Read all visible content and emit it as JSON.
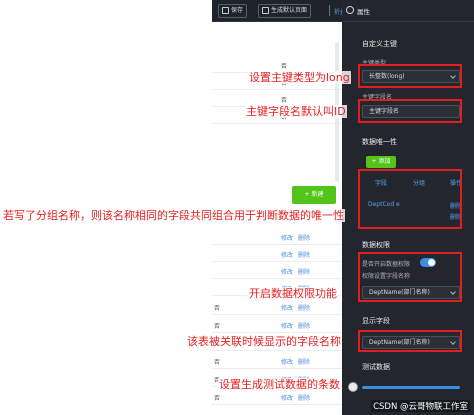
{
  "toolbar": {
    "save_label": "保存",
    "default_page_label": "生成默认页面",
    "collapse_label": "折叠属性"
  },
  "table": {
    "rows_top": [
      {
        "value": "否"
      },
      {
        "value": "否"
      },
      {
        "value": "否"
      },
      {
        "value": "否"
      }
    ],
    "new_button_label": "新建",
    "rows_bottom": [
      {
        "edit": "修改",
        "delete": "删除"
      },
      {
        "edit": "修改",
        "delete": "删除"
      },
      {
        "edit": "修改",
        "delete": "删除"
      },
      {
        "edit": "修改",
        "delete": "删除"
      },
      {
        "no": "否",
        "edit": "修改",
        "delete": "删除"
      },
      {
        "no": "否",
        "edit": "修改",
        "delete": "删除"
      },
      {
        "no": "否",
        "edit": "修改",
        "delete": "删除"
      },
      {
        "no": "否",
        "edit": "修改",
        "delete": "删除"
      },
      {
        "no": "否",
        "edit": "修改",
        "delete": "删除"
      },
      {
        "no": "否",
        "edit": "修改",
        "delete": "删除"
      }
    ]
  },
  "panel": {
    "header_title": "属性",
    "custom_pk_title": "自定义主键",
    "pk_type_label": "主键类型",
    "pk_type_value": "长整数(long)",
    "pk_field_label": "主键字段名",
    "pk_field_value": "主键字段名",
    "unique_title": "数据唯一性",
    "add_label": "添加",
    "unique_cols": {
      "field": "字段",
      "group": "分组",
      "action": "操作"
    },
    "unique_rows": [
      {
        "field": "DeptCod e",
        "delete": "删除"
      },
      {
        "field": "",
        "delete": "删除"
      }
    ],
    "perm_title": "数据权限",
    "perm_enable_label": "是否开启数据权限",
    "perm_field_label": "权限设置字段名称",
    "perm_field_value": "DeptName(部门名称)",
    "display_field_title": "显示字段",
    "display_field_value": "DeptName(部门名称)",
    "test_data_title": "测试数据"
  },
  "annotations": {
    "pk_type": "设置主键类型为long",
    "pk_field": "主键字段名默认叫ID",
    "unique_group": "若写了分组名称，则该名称相同的字段共同组合用于判断数据的唯一性",
    "perm_enable": "开启数据权限功能",
    "display_field": "该表被关联时候显示的字段名称",
    "test_data": "设置生成测试数据的条数"
  },
  "watermark": "CSDN @云哥物联工作室",
  "colors": {
    "panel_bg": "#23262d",
    "accent_blue": "#3a8ee6",
    "add_green": "#52c41a",
    "annotation_red": "#e82020"
  }
}
